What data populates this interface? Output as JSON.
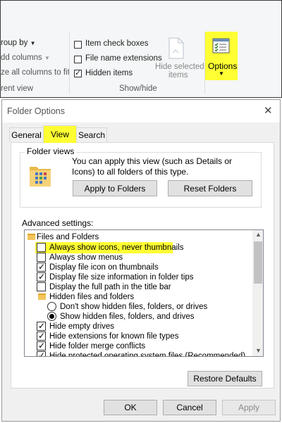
{
  "ribbon": {
    "group_by": "roup by",
    "add_columns": "dd columns",
    "size_all": "ze all columns to fit",
    "current_view": "rent view",
    "item_checkboxes": {
      "label": "Item check boxes",
      "checked": false
    },
    "file_name_extensions": {
      "label": "File name extensions",
      "checked": false
    },
    "hidden_items": {
      "label": "Hidden items",
      "checked": true
    },
    "hide_selected_line1": "Hide selected",
    "hide_selected_line2": "items",
    "show_hide_group": "Show/hide",
    "options_label": "Options",
    "highlight_color": "#ffff33"
  },
  "dialog": {
    "title": "Folder Options",
    "tabs": [
      {
        "label": "General",
        "active": false
      },
      {
        "label": "View",
        "active": true
      },
      {
        "label": "Search",
        "active": false
      }
    ],
    "folder_views": {
      "title": "Folder views",
      "description": "You can apply this view (such as Details or Icons) to all folders of this type.",
      "apply_button": "Apply to Folders",
      "reset_button": "Reset Folders"
    },
    "advanced_label": "Advanced settings:",
    "tree": [
      {
        "kind": "folder",
        "label": "Files and Folders"
      },
      {
        "kind": "check",
        "label": "Always show icons, never thumbnails",
        "checked": false,
        "highlighted": true
      },
      {
        "kind": "check",
        "label": "Always show menus",
        "checked": false
      },
      {
        "kind": "check",
        "label": "Display file icon on thumbnails",
        "checked": true
      },
      {
        "kind": "check",
        "label": "Display file size information in folder tips",
        "checked": true
      },
      {
        "kind": "check",
        "label": "Display the full path in the title bar",
        "checked": false
      },
      {
        "kind": "folder",
        "label": "Hidden files and folders"
      },
      {
        "kind": "radio",
        "label": "Don't show hidden files, folders, or drives",
        "checked": false
      },
      {
        "kind": "radio",
        "label": "Show hidden files, folders, and drives",
        "checked": true
      },
      {
        "kind": "check",
        "label": "Hide empty drives",
        "checked": true
      },
      {
        "kind": "check",
        "label": "Hide extensions for known file types",
        "checked": true
      },
      {
        "kind": "check",
        "label": "Hide folder merge conflicts",
        "checked": true
      },
      {
        "kind": "check",
        "label": "Hide protected operating system files (Recommended)",
        "checked": true
      }
    ],
    "restore_button": "Restore Defaults",
    "ok_button": "OK",
    "cancel_button": "Cancel",
    "apply_button": "Apply"
  }
}
